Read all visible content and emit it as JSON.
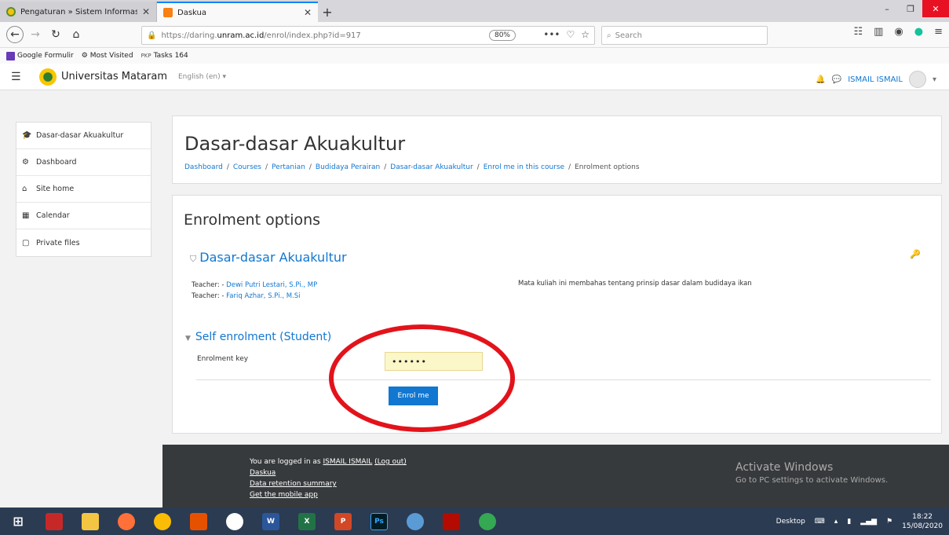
{
  "browser": {
    "tabs": [
      {
        "title": "Pengaturan » Sistem Informasi",
        "close": "✕"
      },
      {
        "title": "Daskua",
        "close": "✕"
      }
    ],
    "new_tab": "+",
    "window_controls": {
      "minimize": "–",
      "maximize": "❐",
      "close": "✕"
    },
    "url_prefix": "https://daring.",
    "url_host": "unram.ac.id",
    "url_path": "/enrol/index.php?id=917",
    "zoom": "80%",
    "url_icons": [
      "•••",
      "♡",
      "☆"
    ],
    "search_placeholder": "Search",
    "bookmarks": [
      "Google Formulir",
      "Most Visited",
      "Tasks 164"
    ]
  },
  "header": {
    "brand": "Universitas Mataram",
    "language": "English (en) ▾",
    "user": "ISMAIL ISMAIL",
    "user_menu": "▾"
  },
  "sidebar": {
    "items": [
      {
        "icon": "graduation-cap-icon",
        "glyph": "🎓",
        "label": "Dasar-dasar Akuakultur"
      },
      {
        "icon": "dashboard-icon",
        "glyph": "⚙",
        "label": "Dashboard"
      },
      {
        "icon": "home-icon",
        "glyph": "⌂",
        "label": "Site home"
      },
      {
        "icon": "calendar-icon",
        "glyph": "▦",
        "label": "Calendar"
      },
      {
        "icon": "file-icon",
        "glyph": "▢",
        "label": "Private files"
      }
    ]
  },
  "course": {
    "title": "Dasar-dasar Akuakultur",
    "breadcrumb": [
      "Dashboard",
      "Courses",
      "Pertanian",
      "Budidaya Perairan",
      "Dasar-dasar Akuakultur",
      "Enrol me in this course",
      "Enrolment options"
    ],
    "separator": "/"
  },
  "enrolment": {
    "heading": "Enrolment options",
    "course_name": "Dasar-dasar Akuakultur",
    "teacher_label": "Teacher:",
    "teachers": [
      "Dewi Putri Lestari, S.Pi., MP",
      "Fariq Azhar, S.Pi., M.Si"
    ],
    "summary": "Mata kuliah ini membahas tentang prinsip dasar dalam budidaya ikan",
    "self_enrol_title": "Self enrolment (Student)",
    "key_label": "Enrolment key",
    "key_value": "••••••",
    "button": "Enrol me"
  },
  "footer": {
    "logged_in_prefix": "You are logged in as ",
    "user": "ISMAIL ISMAIL",
    "logout": "(Log out)",
    "links": [
      "Daskua",
      "Data retention summary",
      "Get the mobile app"
    ],
    "activate_title": "Activate Windows",
    "activate_sub": "Go to PC settings to activate Windows."
  },
  "taskbar": {
    "desktop_label": "Desktop",
    "time": "18:22",
    "date": "15/08/2020",
    "apps": [
      "W",
      "X",
      "P",
      "Ps"
    ]
  },
  "colors": {
    "accent": "#1177d1",
    "circle": "#e3131b",
    "key_bg": "#fcf7c8"
  }
}
